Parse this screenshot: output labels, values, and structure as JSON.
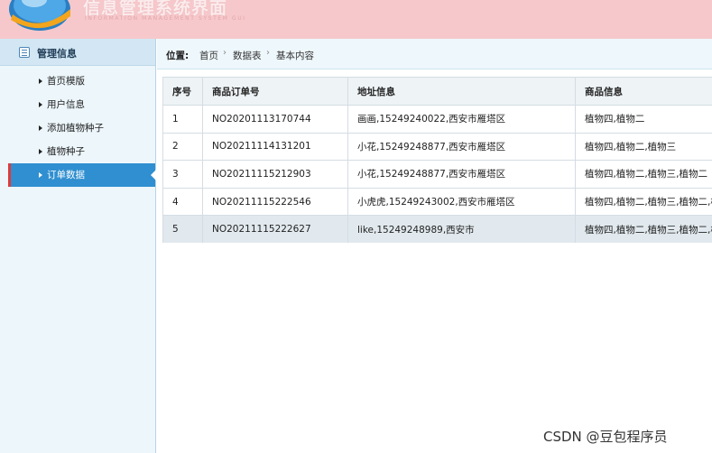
{
  "header": {
    "title": "信息管理系统界面",
    "subtitle": "INFORMATION MANAGEMENT SYSTEM GUI"
  },
  "sidebar": {
    "title": "管理信息",
    "items": [
      {
        "label": "首页模版"
      },
      {
        "label": "用户信息"
      },
      {
        "label": "添加植物种子"
      },
      {
        "label": "植物种子"
      },
      {
        "label": "订单数据",
        "active": true
      }
    ]
  },
  "breadcrumb": {
    "label": "位置:",
    "items": [
      "首页",
      "数据表",
      "基本内容"
    ]
  },
  "table": {
    "columns": [
      "序号",
      "商品订单号",
      "地址信息",
      "商品信息"
    ],
    "rows": [
      [
        "1",
        "NO20201113170744",
        "画画,15249240022,西安市雁塔区",
        "植物四,植物二"
      ],
      [
        "2",
        "NO20211114131201",
        "小花,15249248877,西安市雁塔区",
        "植物四,植物二,植物三"
      ],
      [
        "3",
        "NO20211115212903",
        "小花,15249248877,西安市雁塔区",
        "植物四,植物二,植物三,植物二"
      ],
      [
        "4",
        "NO20211115222546",
        "小虎虎,15249243002,西安市雁塔区",
        "植物四,植物二,植物三,植物二,植物"
      ],
      [
        "5",
        "NO20211115222627",
        "like,15249248989,西安市",
        "植物四,植物二,植物三,植物二,植物"
      ]
    ]
  },
  "watermark": "CSDN @豆包程序员",
  "colors": {
    "header_bg": "#f6c8cb",
    "sidebar_bg": "#ecf6fb",
    "active_item": "#2f8fd0",
    "active_marker": "#e03a3a"
  }
}
